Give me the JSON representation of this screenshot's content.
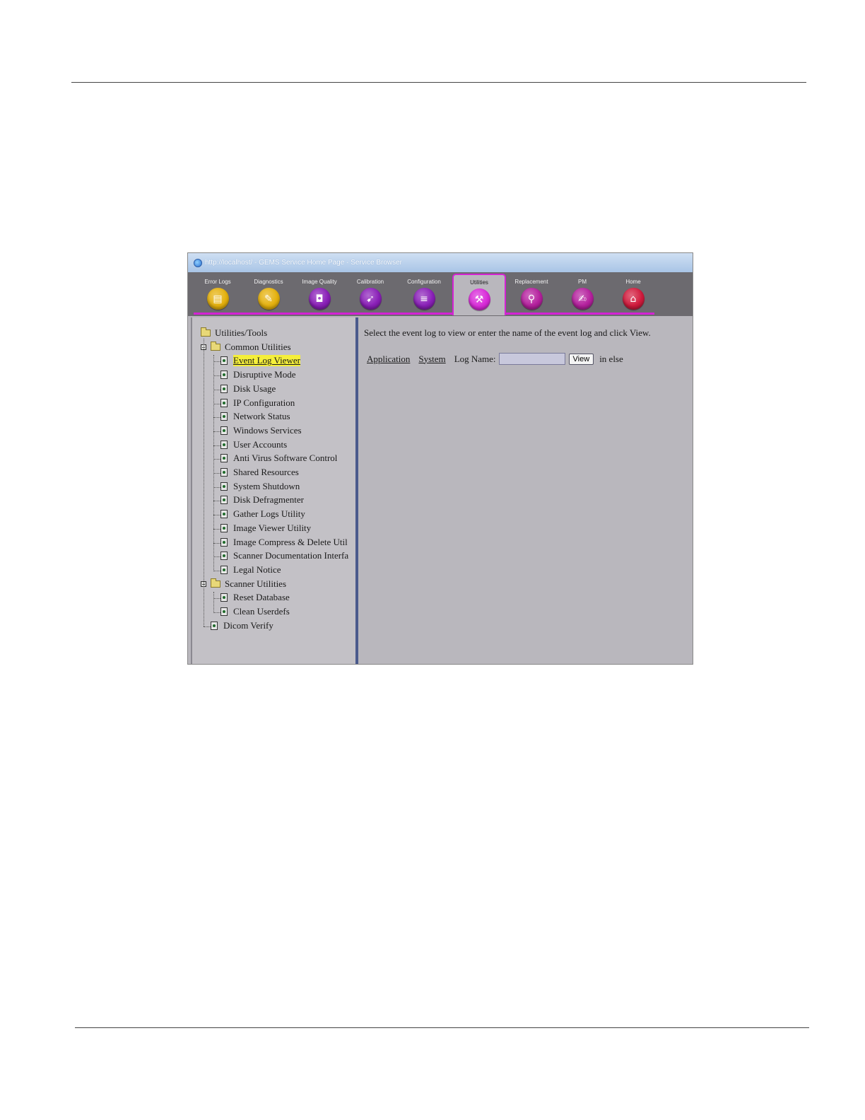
{
  "window": {
    "title": "http://localhost/ - GEMS Service Home Page - Service Browser"
  },
  "tabs": [
    {
      "label": "Error Logs",
      "color": "#e5b10d",
      "glyph": "▤"
    },
    {
      "label": "Diagnostics",
      "color": "#e5b10d",
      "glyph": "✎"
    },
    {
      "label": "Image Quality",
      "color": "#8a1fb8",
      "glyph": "◘"
    },
    {
      "label": "Calibration",
      "color": "#8a1fb8",
      "glyph": "➹"
    },
    {
      "label": "Configuration",
      "color": "#8a1fb8",
      "glyph": "≡"
    },
    {
      "label": "Utilities",
      "color": "#d92ad9",
      "glyph": "⚒"
    },
    {
      "label": "Replacement",
      "color": "#b5209e",
      "glyph": "⚲"
    },
    {
      "label": "PM",
      "color": "#b5209e",
      "glyph": "✍"
    },
    {
      "label": "Home",
      "color": "#d11a3c",
      "glyph": "⌂"
    }
  ],
  "active_tab": "Utilities",
  "tree": {
    "root": "Utilities/Tools",
    "common_group": "Common Utilities",
    "common_items": [
      "Event Log Viewer",
      "Disruptive Mode",
      "Disk Usage",
      "IP Configuration",
      "Network Status",
      "Windows Services",
      "User Accounts",
      "Anti Virus Software Control",
      "Shared Resources",
      "System Shutdown",
      "Disk Defragmenter",
      "Gather Logs Utility",
      "Image Viewer Utility",
      "Image Compress & Delete Util",
      "Scanner Documentation Interfa",
      "Legal Notice"
    ],
    "scanner_group": "Scanner Utilities",
    "scanner_items": [
      "Reset Database",
      "Clean Userdefs"
    ],
    "extra_item": "Dicom Verify",
    "selected": "Event Log Viewer"
  },
  "content": {
    "instructions": "Select the event log to view or enter the name of the event log and click View.",
    "link_application": "Application",
    "link_system": "System",
    "log_name_label": "Log Name:",
    "log_name_value": "",
    "view_button": "View",
    "trailing_text": "in else"
  }
}
